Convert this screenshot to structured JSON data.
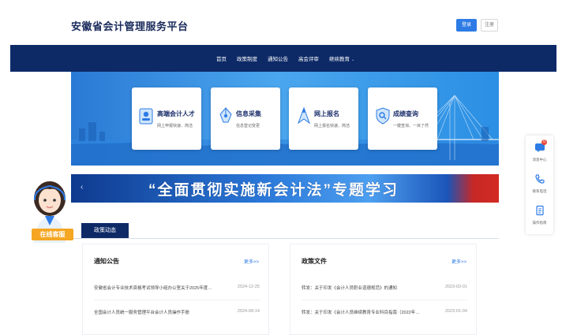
{
  "header": {
    "brand": "安徽省会计管理服务平台",
    "login_label": "登录",
    "register_label": "注册"
  },
  "nav": {
    "items": [
      {
        "label": "首页"
      },
      {
        "label": "政策制度"
      },
      {
        "label": "通知公告"
      },
      {
        "label": "高会评审"
      },
      {
        "label": "继续教育"
      }
    ]
  },
  "hero_cards": [
    {
      "title": "高端会计人才",
      "subtitle": "网上申报快速、简洁",
      "icon": "person-card-icon"
    },
    {
      "title": "信息采集",
      "subtitle": "信息登记变更",
      "icon": "pen-nib-icon"
    },
    {
      "title": "网上报名",
      "subtitle": "网上报名快速、简洁",
      "icon": "compass-icon"
    },
    {
      "title": "成绩查询",
      "subtitle": "一键查询、一目了然",
      "icon": "shield-search-icon"
    }
  ],
  "banner": {
    "text": "“全面贯彻实施新会计法”专题学习"
  },
  "section": {
    "tag": "政策动态"
  },
  "customer_service": {
    "label": "在线客服"
  },
  "panels": [
    {
      "title": "通知公告",
      "more": "更多>>",
      "rows": [
        {
          "text": "安徽省会计专业技术资格考试领导小组办公室关于2025年度…",
          "date": "2024-12-25"
        },
        {
          "text": "全国会计人员统一服务管理平台会计人员操作手册",
          "date": "2024-08-14"
        }
      ]
    },
    {
      "title": "政策文件",
      "more": "更多>>",
      "rows": [
        {
          "text": "转发：关于印发《会计人员职业道德规范》的通知",
          "date": "2023-02-01"
        },
        {
          "text": "转发：关于印发《会计人员继续教育专业科目指南（2022年…",
          "date": "2023-01-04"
        }
      ]
    }
  ],
  "side_tools": [
    {
      "label": "消息中心",
      "badge": "0",
      "icon": "message-icon"
    },
    {
      "label": "联系电话",
      "icon": "phone-icon"
    },
    {
      "label": "操作指南",
      "icon": "guide-book-icon"
    }
  ],
  "colors": {
    "nav_bg": "#0d2a67",
    "accent": "#2d7be5",
    "cs_label": "#f5a623"
  }
}
